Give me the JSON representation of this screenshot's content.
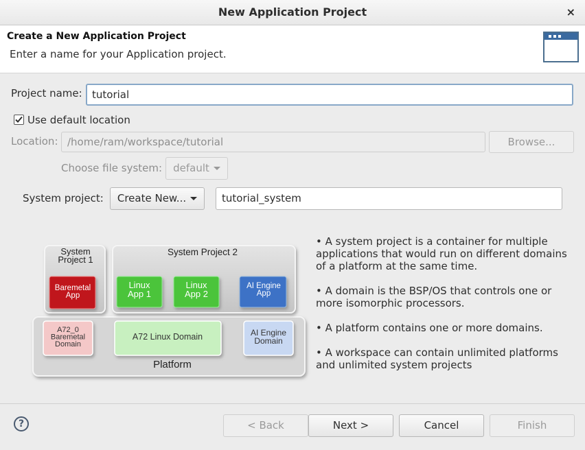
{
  "window": {
    "title": "New Application Project",
    "close_glyph": "×"
  },
  "header": {
    "title": "Create a New Application Project",
    "subtitle": "Enter a name for your Application project.",
    "icon": "wizard-window-icon"
  },
  "form": {
    "project_name_label": "Project name:",
    "project_name_value": "tutorial",
    "use_default_location_label": "Use default location",
    "use_default_location_checked": true,
    "location_label": "Location:",
    "location_value": "/home/ram/workspace/tutorial",
    "browse_label": "Browse...",
    "file_system_label": "Choose file system:",
    "file_system_value": "default",
    "system_project_label": "System project:",
    "system_project_option": "Create New...",
    "system_project_name": "tutorial_system"
  },
  "diagram": {
    "system_project_1": "System\nProject 1",
    "system_project_2": "System Project 2",
    "baremetal_app": "Baremetal\nApp",
    "linux_app_1": "Linux\nApp 1",
    "linux_app_2": "Linux\nApp 2",
    "ai_engine_app": "AI Engine\nApp",
    "a72_0_baremetal_domain": "A72_0\nBaremetal\nDomain",
    "a72_linux_domain": "A72 Linux Domain",
    "ai_engine_domain": "AI Engine\nDomain",
    "platform": "Platform",
    "colors": {
      "baremetal": "#c0141c",
      "linux": "#4cc43a",
      "ai": "#3d72c6",
      "baremetal_domain": "#f4c8c8",
      "linux_domain": "#c8f0c0",
      "ai_domain": "#c8d8f2"
    }
  },
  "info": {
    "bullet_1": "• A system project is a container for multiple applications that would run on different domains of a platform at the same time.",
    "bullet_2": "• A domain is the BSP/OS that controls one or more isomorphic processors.",
    "bullet_3": "• A platform contains one or more domains.",
    "bullet_4": "• A workspace can contain unlimited platforms and unlimited system projects"
  },
  "footer": {
    "help_glyph": "?",
    "back_label": "< Back",
    "next_label": "Next >",
    "cancel_label": "Cancel",
    "finish_label": "Finish"
  }
}
